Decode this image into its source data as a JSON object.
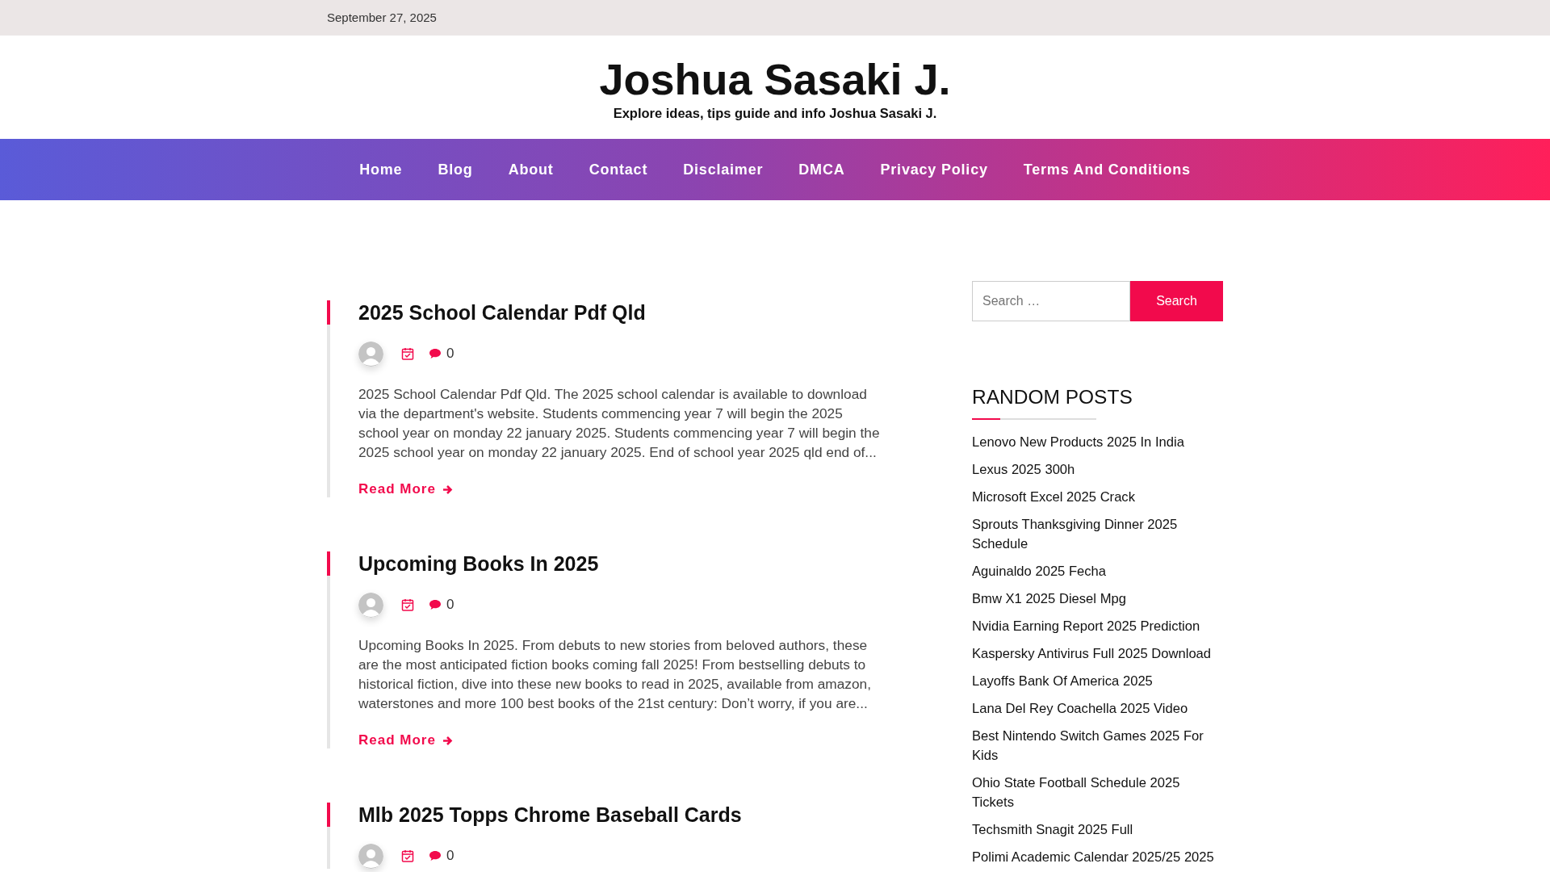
{
  "top_bar": {
    "date": "September 27, 2025"
  },
  "header": {
    "title": "Joshua Sasaki J.",
    "tagline": "Explore ideas, tips guide and info Joshua Sasaki J."
  },
  "nav": [
    {
      "label": "Home"
    },
    {
      "label": "Blog"
    },
    {
      "label": "About"
    },
    {
      "label": "Contact"
    },
    {
      "label": "Disclaimer"
    },
    {
      "label": "DMCA"
    },
    {
      "label": "Privacy Policy"
    },
    {
      "label": "Terms And Conditions"
    }
  ],
  "posts": [
    {
      "title": "2025 School Calendar Pdf Qld",
      "comments": "0",
      "excerpt": "2025 School Calendar Pdf Qld. The 2025 school calendar is available to download via the department's website. Students commencing year 7 will begin the 2025 school year on monday 22 january 2025. Students commencing year 7 will begin the 2025 school year on monday 22 january 2025. End of school year 2025 qld end of...",
      "read_more": "Read More"
    },
    {
      "title": "Upcoming Books In 2025",
      "comments": "0",
      "excerpt": "Upcoming Books In 2025. From debuts to new stories from beloved authors, these are the most anticipated fiction books coming fall 2025! From bestselling debuts to historical fiction, dive into these new books to read in 2025, available from amazon, waterstones and more 100 best books of the 21st century: Don’t worry, if you are...",
      "read_more": "Read More"
    },
    {
      "title": "Mlb 2025 Topps Chrome Baseball Cards",
      "comments": "0"
    }
  ],
  "sidebar": {
    "search": {
      "placeholder": "Search …",
      "button": "Search"
    },
    "random_posts": {
      "heading": "RANDOM POSTS",
      "items": [
        "Lenovo New Products 2025 In India",
        "Lexus 2025 300h",
        "Microsoft Excel 2025 Crack",
        "Sprouts Thanksgiving Dinner 2025 Schedule",
        "Aguinaldo 2025 Fecha",
        "Bmw X1 2025 Diesel Mpg",
        "Nvidia Earning Report 2025 Prediction",
        "Kaspersky Antivirus Full 2025 Download",
        "Layoffs Bank Of America 2025",
        "Lana Del Rey Coachella 2025 Video",
        "Best Nintendo Switch Games 2025 For Kids",
        "Ohio State Football Schedule 2025 Tickets",
        "Techsmith Snagit 2025 Full",
        "Polimi Academic Calendar 2025/25 2025"
      ]
    }
  }
}
